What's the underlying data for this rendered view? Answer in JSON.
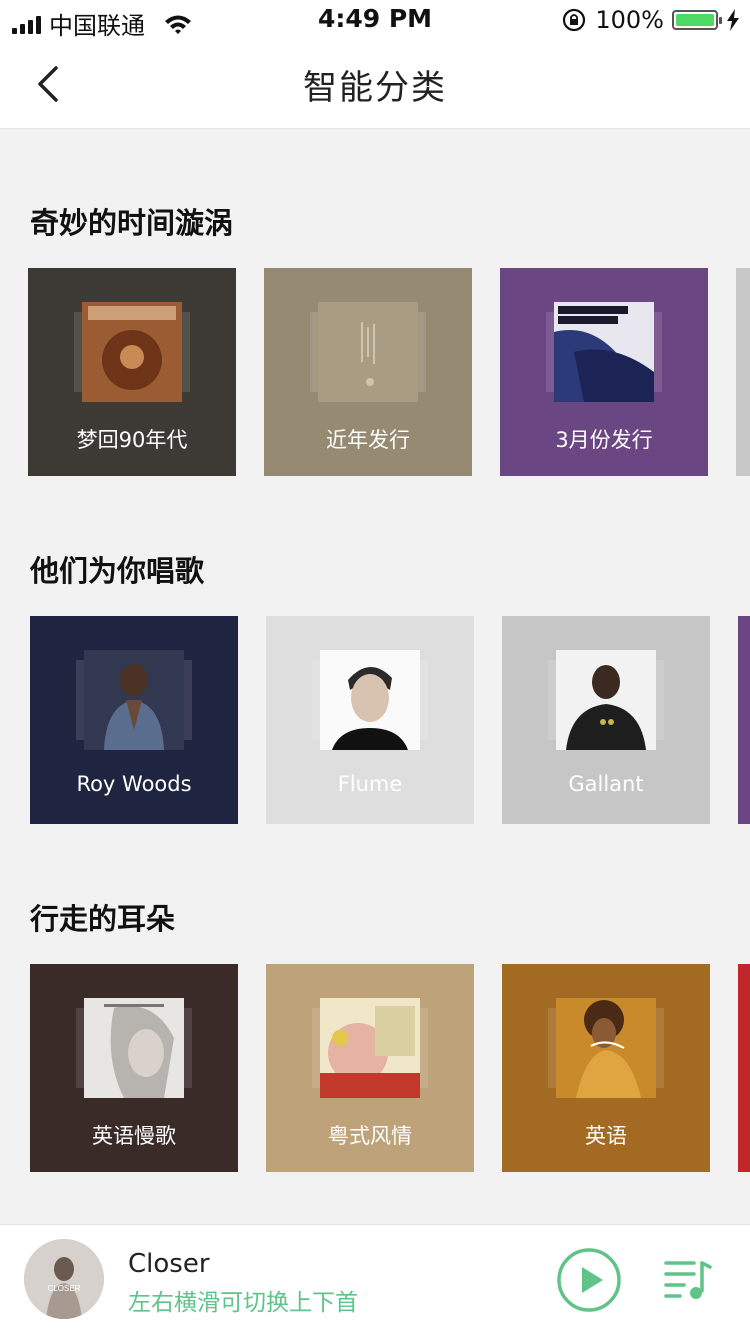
{
  "status_bar": {
    "carrier": "中国联通",
    "time": "4:49 PM",
    "battery": "100%",
    "battery_level": 1.0
  },
  "nav": {
    "title": "智能分类",
    "back_icon": "chevron-left-icon"
  },
  "sections": [
    {
      "title": "奇妙的时间漩涡",
      "cards": [
        {
          "label": "梦回90年代",
          "bg": "#3d3a35",
          "cover": "#8a4a2a"
        },
        {
          "label": "近年发行",
          "bg": "#968a72",
          "cover": "#a99c82"
        },
        {
          "label": "3月份发行",
          "bg": "#6a4683",
          "cover": "#2c3a7a"
        }
      ],
      "peek_color": "#c8c8c8"
    },
    {
      "title": "他们为你唱歌",
      "cards": [
        {
          "label": "Roy Woods",
          "bg": "#1f2440",
          "cover": "#323850"
        },
        {
          "label": "Flume",
          "bg": "#dedede",
          "cover": "#9a9a9a"
        },
        {
          "label": "Gallant",
          "bg": "#c6c6c6",
          "cover": "#2a2a2a"
        }
      ],
      "peek_color": "#6a4683"
    },
    {
      "title": "行走的耳朵",
      "cards": [
        {
          "label": "英语慢歌",
          "bg": "#3a2a28",
          "cover": "#b7b3ae"
        },
        {
          "label": "粤式风情",
          "bg": "#bda27a",
          "cover": "#d9cfa0"
        },
        {
          "label": "英语",
          "bg": "#a26a22",
          "cover": "#c98a2c"
        }
      ],
      "peek_color": "#c0262a"
    }
  ],
  "player": {
    "title": "Closer",
    "subtitle": "左右横滑可切换上下首",
    "accent": "#5fc38a",
    "cover_text": "CLOSER"
  }
}
